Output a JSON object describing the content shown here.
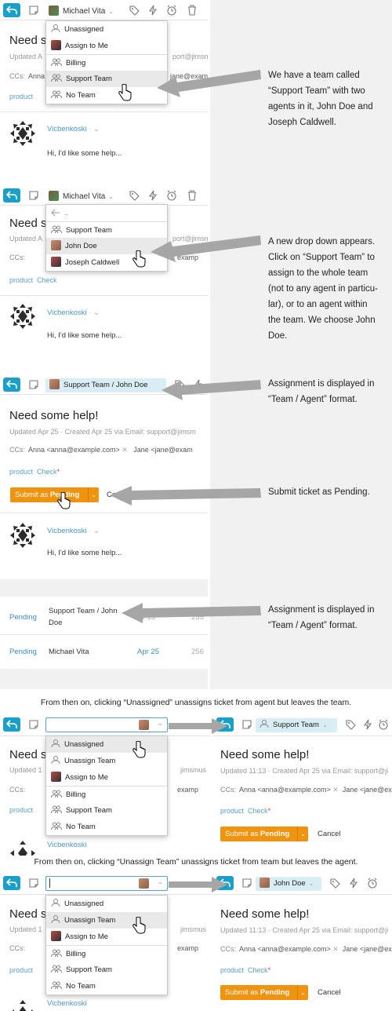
{
  "colors": {
    "accent": "#1aa0c8",
    "submit": "#f0930f",
    "tag_link": "#5aa0c4",
    "arrow": "#a6a6a6"
  },
  "ticket": {
    "title": "Need some help!",
    "title_cut": "Need s",
    "updated_label": "Updated",
    "updated": "Updated Apr 25",
    "created": "Created Apr 25",
    "via": "via Email: support@jimsmus",
    "meta_full": "Updated Apr 25 · Created Apr 25 via Email: support@jimsm",
    "meta_full2": "Updated 11:13 · Created Apr 25 via Email: support@ji",
    "meta_cut1": "Updated A",
    "meta_cut1b": "port@jimsm",
    "meta_cut2": "Updated 1",
    "meta_cut2b": "jimsmus",
    "ccs_label": "CCs:",
    "cc1": "Anna <anna@example.com>",
    "cc2": "Jane <jane@exam",
    "cc_cut1": "Anna",
    "cc_cut1b": "jane@exam",
    "cc_cut2": "Ann",
    "cc_cut2b": "examp",
    "tag1": "product",
    "tag2": "Check",
    "tag_req": "*",
    "submit_prefix": "Submit as ",
    "submit_status": "Pending",
    "cancel": "Cancel",
    "author": "Vicbenkoski",
    "author_dot": "·",
    "author_chev": "⌄",
    "body": "Hi, I'd like some help..."
  },
  "assignees": {
    "michael": "Michael Vita",
    "team_agent": "Support Team / John Doe",
    "support_team": "Support Team",
    "john": "John Doe"
  },
  "menu": {
    "unassigned": "Unassigned",
    "assign_to_me": "Assign to Me",
    "billing": "Billing",
    "support_team": "Support Team",
    "no_team": "No Team",
    "back": "..",
    "john_doe": "John Doe",
    "joseph": "Joseph Caldwell",
    "unassign_team": "Unassign Team"
  },
  "notes": {
    "n1": [
      "We have a team called",
      "“Support Team” with two",
      "agents in it, John Doe and",
      "Joseph Caldwell."
    ],
    "n2": [
      "A new drop down appears.",
      "Click on “Support Team” to",
      "assign to the whole team",
      "(not to any agent in particu-",
      "lar), or to an agent within",
      "the team. We choose John",
      "Doe."
    ],
    "n3": [
      "Assignment is displayed in",
      "“Team / Agent” format."
    ],
    "n4": [
      "Submit ticket as Pending."
    ],
    "n5": [
      "Assignment is displayed in",
      "“Team / Agent” format."
    ],
    "full1": "From then on, clicking “Unassigned” unassigns ticket from agent but leaves the team.",
    "full2": "From then on, clicking “Unassign Team” unassigns ticket from team but leaves the agent."
  },
  "list": [
    {
      "status": "Pending",
      "assignee_line1": "Support Team / John",
      "assignee_line2": "Doe",
      "time": "11:13",
      "id": "255"
    },
    {
      "status": "Pending",
      "assignee": "Michael Vita",
      "time": "Apr 25",
      "id": "256"
    }
  ]
}
